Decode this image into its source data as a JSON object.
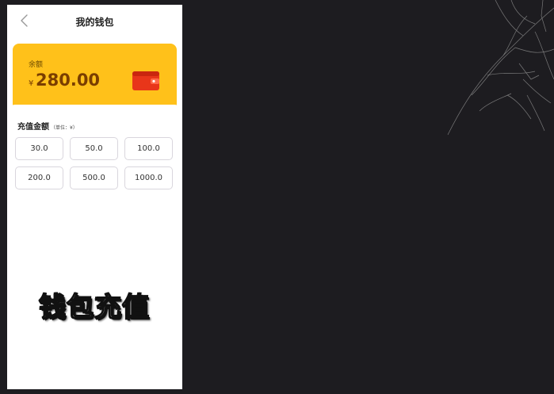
{
  "nav": {
    "title": "我的钱包",
    "back_icon": "chevron-left-icon"
  },
  "balance_card": {
    "label": "余额",
    "currency_symbol": "¥",
    "amount": "280.00",
    "icon": "wallet-icon",
    "background_color": "#ffc11a",
    "text_color": "#7a3e00"
  },
  "recharge": {
    "title": "充值金额",
    "unit": "（单位：¥）",
    "amounts": [
      "30.0",
      "50.0",
      "100.0",
      "200.0",
      "500.0",
      "1000.0"
    ]
  },
  "caption": "钱包充值",
  "background_color": "#1d1c20"
}
